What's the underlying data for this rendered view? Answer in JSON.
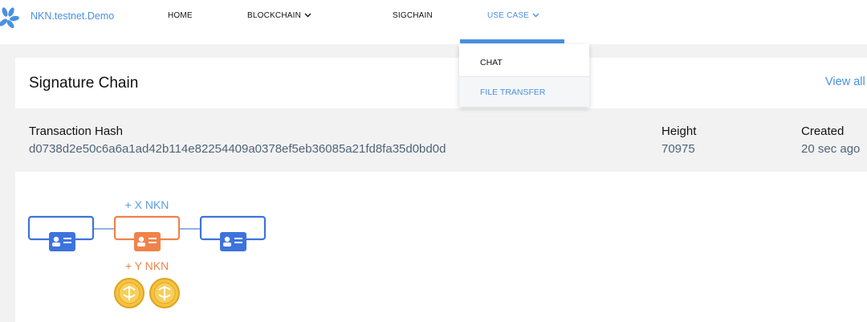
{
  "nav": {
    "brand": "NKN.testnet.Demo",
    "items": [
      {
        "label": "HOME"
      },
      {
        "label": "BLOCKCHAIN"
      },
      {
        "label": "SIGCHAIN"
      },
      {
        "label": "USE CASE"
      }
    ],
    "dropdown": [
      {
        "label": "CHAT"
      },
      {
        "label": "FILE TRANSFER"
      }
    ]
  },
  "card": {
    "title": "Signature Chain",
    "view_all": "View all"
  },
  "meta": {
    "hash_label": "Transaction Hash",
    "hash_value": "d0738d2e50c6a6a1ad42b114e82254409a0378ef5eb36085a21fd8fa35d0bd0d",
    "height_label": "Height",
    "height_value": "70975",
    "created_label": "Created",
    "created_value": "20 sec ago"
  },
  "diagram": {
    "reward_x": "+ X NKN",
    "reward_y": "+ Y NKN"
  },
  "colors": {
    "accent": "#4a90e2",
    "node_blue": "#3d73dd",
    "node_orange": "#f0834a",
    "coin": "#f5c342"
  }
}
